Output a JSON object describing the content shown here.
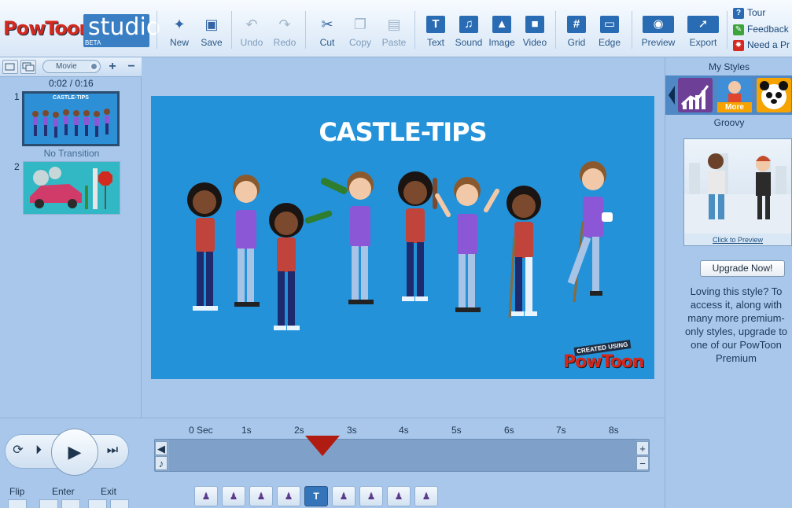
{
  "brand": {
    "logo": "PowToon",
    "studio": "studio",
    "badge": "BETA"
  },
  "toolbar": {
    "new": "New",
    "save": "Save",
    "undo": "Undo",
    "redo": "Redo",
    "cut": "Cut",
    "copy": "Copy",
    "paste": "Paste",
    "text": "Text",
    "sound": "Sound",
    "image": "Image",
    "video": "Video",
    "grid": "Grid",
    "edge": "Edge",
    "preview": "Preview",
    "export": "Export"
  },
  "links": {
    "tour": "Tour",
    "feedback": "Feedback",
    "need": "Need a Pr"
  },
  "left": {
    "mode": "Movie",
    "time": "0:02 / 0:16",
    "slide1_num": "1",
    "slide2_num": "2",
    "transition": "No Transition",
    "slide1_title": "CASTLE-TIPS"
  },
  "stage": {
    "title": "CASTLE-TIPS",
    "watermark_top": "CREATED USING",
    "watermark_brand": "PowToon"
  },
  "right": {
    "title": "My Styles",
    "more": "More",
    "style_name": "Groovy",
    "click_preview": "Click to Preview",
    "upgrade": "Upgrade Now!",
    "loving": "Loving this style? To access it, along with many more premium-only styles, upgrade to one of our PowToon Premium"
  },
  "timeline": {
    "ticks": [
      "0 Sec",
      "1s",
      "2s",
      "3s",
      "4s",
      "5s",
      "6s",
      "7s",
      "8s"
    ],
    "flip": "Flip",
    "enter": "Enter",
    "exit": "Exit"
  },
  "colors": {
    "accent": "#2392d9",
    "panel": "#a9c7ea",
    "playhead": "#b01c12",
    "brand_red": "#d32a1f"
  }
}
